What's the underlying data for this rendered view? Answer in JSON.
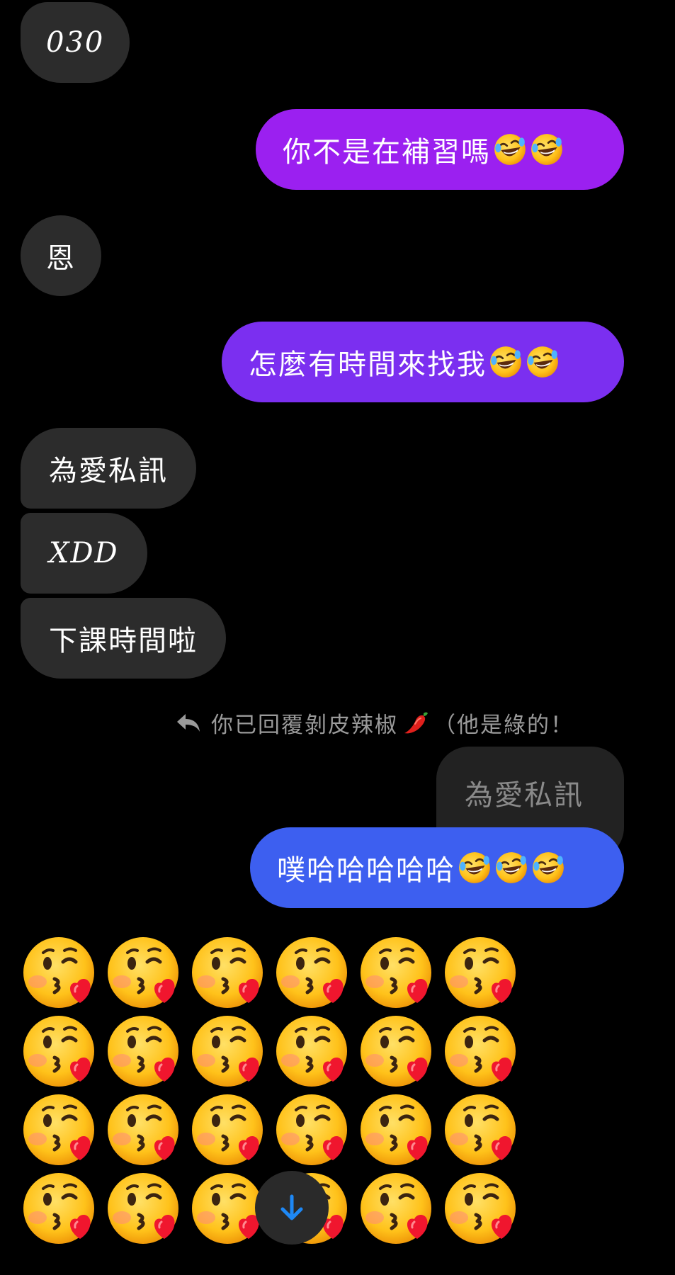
{
  "messages": [
    {
      "id": "m1",
      "side": "incoming",
      "text": "030"
    },
    {
      "id": "m2",
      "side": "outgoing",
      "text": "你不是在補習嗎",
      "emoji_count": 2,
      "emoji": "rolling-on-floor-laughing"
    },
    {
      "id": "m3",
      "side": "incoming",
      "text": "恩"
    },
    {
      "id": "m4",
      "side": "outgoing",
      "text": "怎麼有時間來找我",
      "emoji_count": 2,
      "emoji": "rolling-on-floor-laughing"
    },
    {
      "id": "m5",
      "side": "incoming",
      "text": "為愛私訊"
    },
    {
      "id": "m6",
      "side": "incoming",
      "text": "XDD"
    },
    {
      "id": "m7",
      "side": "incoming",
      "text": "下課時間啦"
    },
    {
      "id": "m8",
      "side": "outgoing",
      "text": "噗哈哈哈哈哈",
      "emoji_count": 3,
      "emoji": "rolling-on-floor-laughing"
    }
  ],
  "reply_note": {
    "prefix": "你已回覆剝皮辣椒",
    "suffix": "（他是綠的！",
    "icon": "reply-arrow-icon",
    "pepper_icon": "hot-pepper-icon"
  },
  "quoted_message": {
    "text": "為愛私訊"
  },
  "emoji_message": {
    "emoji": "face-blowing-a-kiss",
    "count_visible": 24,
    "columns": 6
  },
  "scroll_button": {
    "icon": "arrow-down-icon"
  },
  "colors": {
    "background": "#000000",
    "incoming_bubble": "#2c2c2c",
    "outgoing_gradient_top": "#9b20f0",
    "outgoing_gradient_mid": "#7b2ff0",
    "outgoing_gradient_bottom": "#3d5ff0",
    "quoted_bubble": "#222222",
    "scroll_arrow": "#1e88f5"
  }
}
